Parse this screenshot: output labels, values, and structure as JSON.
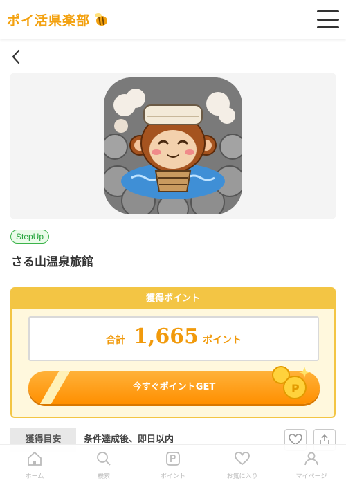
{
  "header": {
    "logo_text": "ポイ活県楽部",
    "menu_icon": "hamburger-menu-icon"
  },
  "back_icon": "chevron-left-icon",
  "offer": {
    "badge": "StepUp",
    "title": "さる山温泉旅館"
  },
  "points": {
    "heading": "獲得ポイント",
    "total_label": "合計",
    "total_value": "1,665",
    "total_unit": "ポイント",
    "cta_label": "今すぐポイントGET"
  },
  "info": {
    "label": "獲得目安",
    "value": "条件達成後、即日以内"
  },
  "tabbar": {
    "items": [
      {
        "label": "ホーム",
        "icon": "home-icon"
      },
      {
        "label": "検索",
        "icon": "search-icon"
      },
      {
        "label": "ポイント",
        "icon": "point-icon"
      },
      {
        "label": "お気に入り",
        "icon": "heart-icon"
      },
      {
        "label": "マイページ",
        "icon": "user-icon"
      }
    ]
  },
  "colors": {
    "accent": "#f3c544",
    "orange": "#ff9a10",
    "badge_green": "#3bb34a"
  }
}
